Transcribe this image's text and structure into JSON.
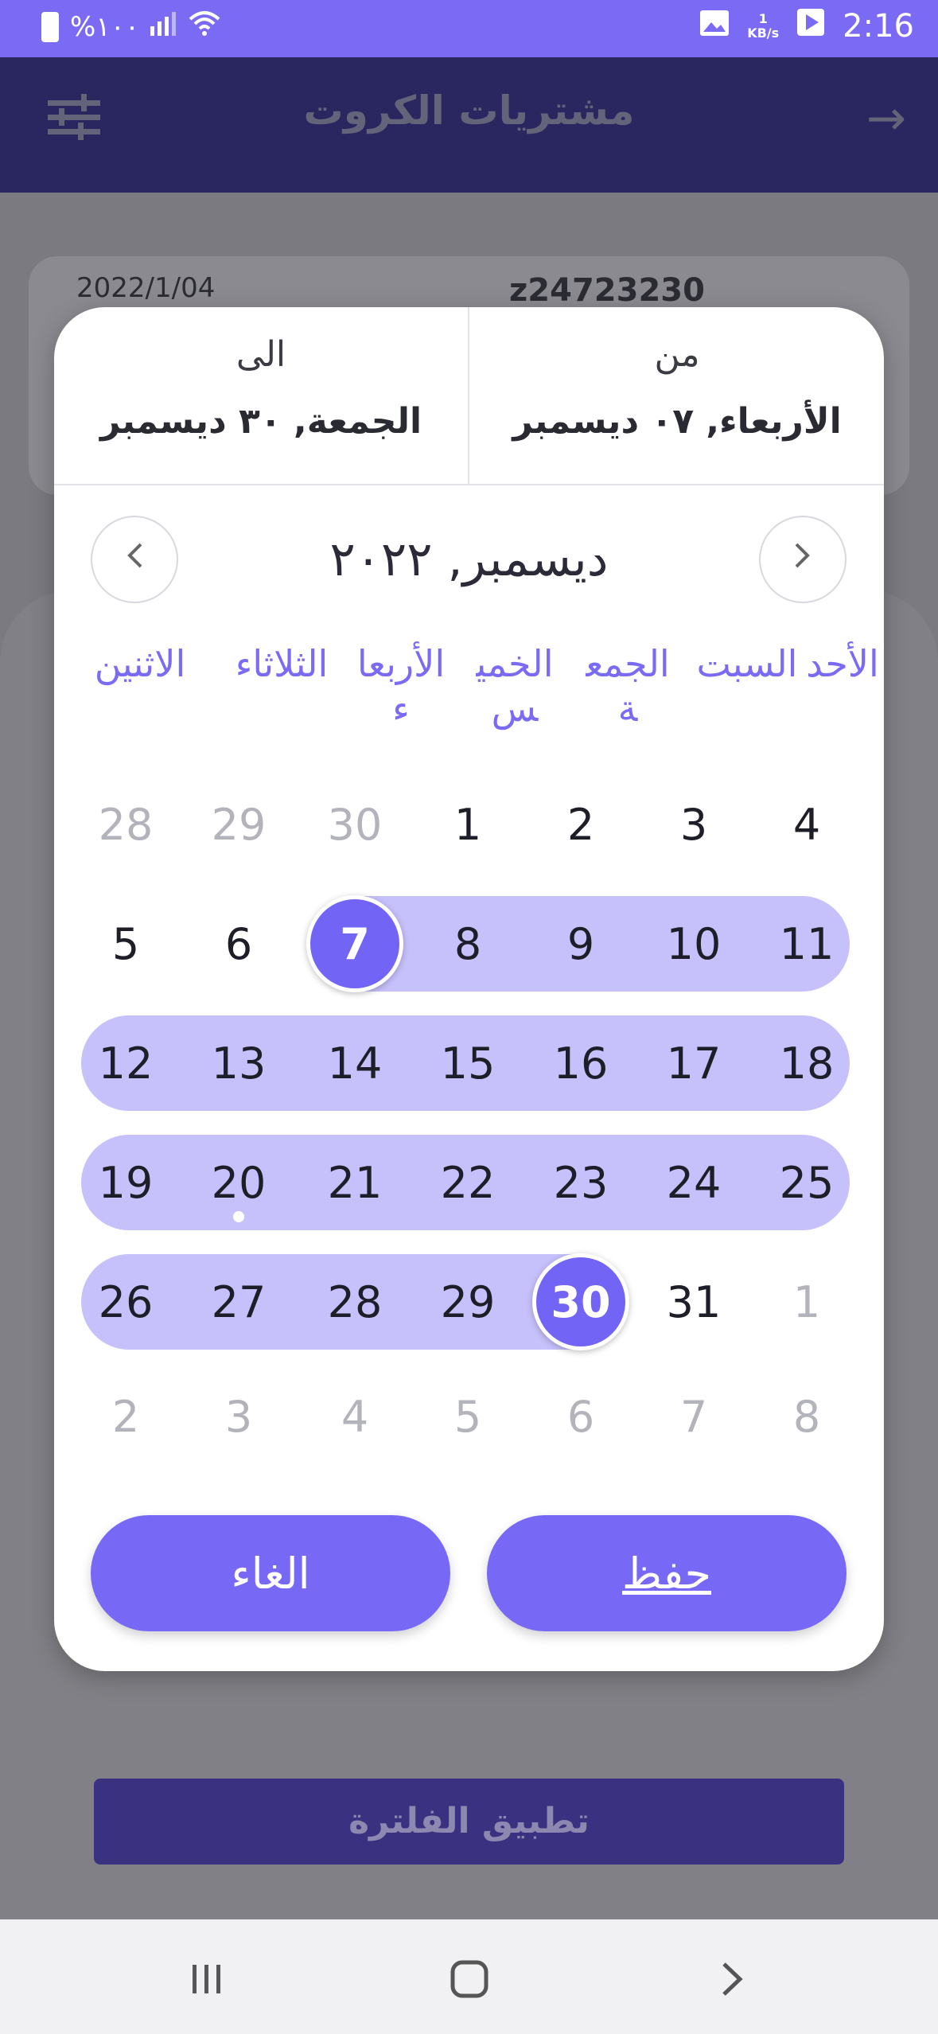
{
  "status_bar": {
    "battery_text": "%١٠٠",
    "network_speed_value": "1",
    "network_speed_unit": "KB/s",
    "time": "2:16"
  },
  "app_bar": {
    "title": "مشتريات الكروت"
  },
  "background": {
    "card_date": "2022/1/04",
    "card_code": "z24723230",
    "apply_button": "تطبيق الفلترة"
  },
  "dialog": {
    "from_label": "من",
    "from_value": "الأربعاء, ٠٧ ديسمبر",
    "to_label": "الى",
    "to_value": "الجمعة, ٣٠ ديسمبر",
    "month_title": "ديسمبر, ٢٠٢٢",
    "weekdays": [
      "الأحد",
      "السبت",
      "الجمعة",
      "الخميس",
      "الأربعاء",
      "الثلاثاء",
      "الاثنين"
    ],
    "weeks": [
      [
        "4",
        "3",
        "2",
        "1",
        "30",
        "29",
        "28"
      ],
      [
        "11",
        "10",
        "9",
        "8",
        "7",
        "6",
        "5"
      ],
      [
        "18",
        "17",
        "16",
        "15",
        "14",
        "13",
        "12"
      ],
      [
        "25",
        "24",
        "23",
        "22",
        "21",
        "20",
        "19"
      ],
      [
        "1",
        "31",
        "30",
        "29",
        "28",
        "27",
        "26"
      ],
      [
        "8",
        "7",
        "6",
        "5",
        "4",
        "3",
        "2"
      ]
    ],
    "save_button": "حفظ",
    "cancel_button": "الغاء"
  },
  "colors": {
    "accent": "#7b6bf4",
    "range_fill": "#c7c1fb",
    "selected": "#7264f5"
  }
}
